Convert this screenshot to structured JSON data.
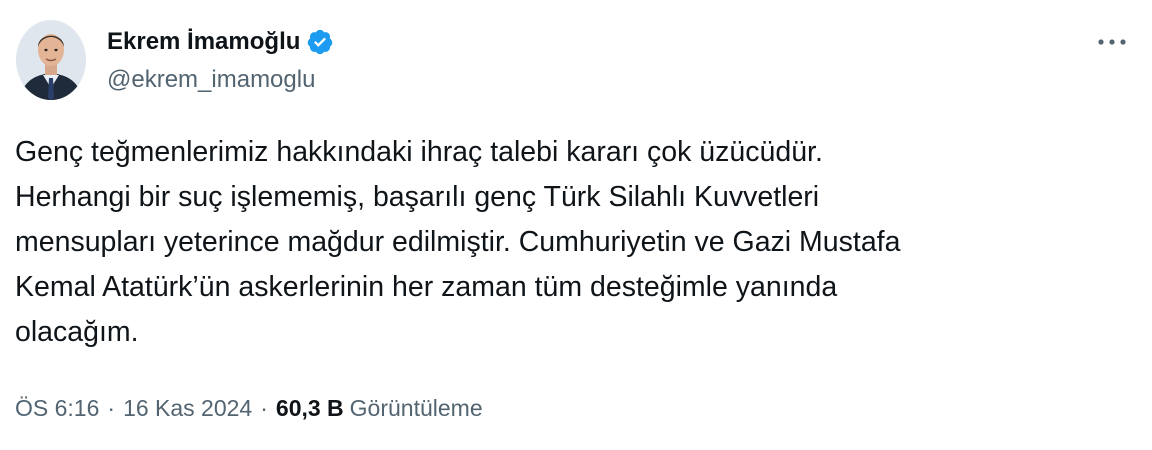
{
  "tweet": {
    "author": {
      "display_name": "Ekrem İmamoğlu",
      "handle": "@ekrem_imamoglu",
      "verified_icon": "verified-badge-icon",
      "verified_color": "#1d9bf0"
    },
    "text": "Genç teğmenlerimiz hakkındaki ihraç talebi kararı çok üzücüdür.\nHerhangi bir suç işlememiş, başarılı genç Türk Silahlı Kuvvetleri\nmensupları yeterince mağdur edilmiştir. Cumhuriyetin ve Gazi Mustafa\nKemal Atatürk’ün askerlerinin her zaman tüm desteğimle yanında\nolacağım.",
    "time": "ÖS 6:16",
    "separator": "·",
    "date": "16 Kas 2024",
    "views_count": "60,3 B",
    "views_label": "Görüntüleme",
    "more_icon": "more-options-icon"
  }
}
